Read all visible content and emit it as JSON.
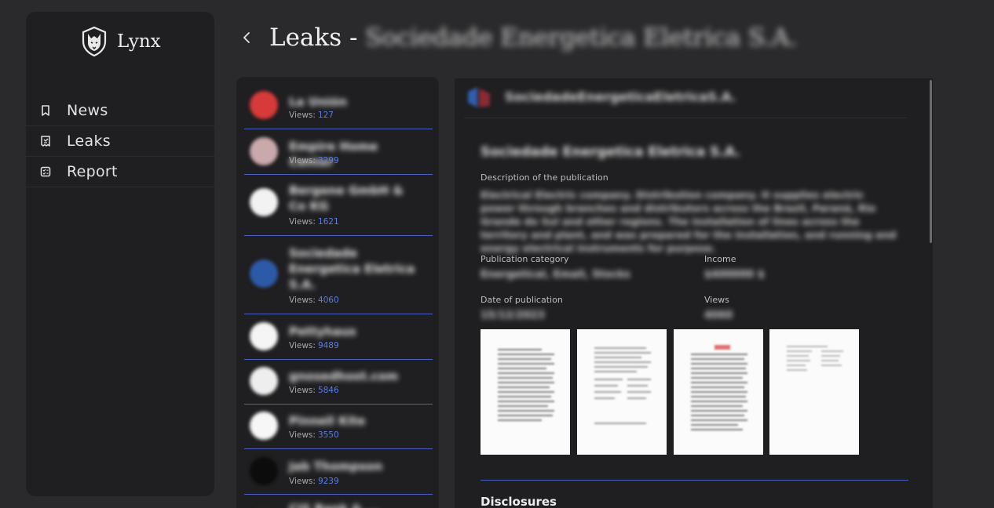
{
  "brand": {
    "name": "Lynx",
    "logo_icon": "wolf-shield-icon"
  },
  "sidebar": {
    "items": [
      {
        "label": "News",
        "icon": "bookmark-icon"
      },
      {
        "label": "Leaks",
        "icon": "receipt-icon"
      },
      {
        "label": "Report",
        "icon": "checklist-icon"
      }
    ]
  },
  "header": {
    "prefix": "Leaks - ",
    "org": "Sociedade Energetica Eletrica S.A."
  },
  "leaks_list": {
    "views_label": "Views:",
    "items": [
      {
        "name": "La Unión",
        "views": "127",
        "avatar_color": "#d83a3a"
      },
      {
        "name": "Empire Home Center",
        "views": "3299",
        "avatar_color": "#c9a9aa"
      },
      {
        "name": "Bergene GmbH & Co KG",
        "views": "1621",
        "avatar_color": "#f2f2f2"
      },
      {
        "name": "Sociedade Energetica Eletrica S.A.",
        "views": "4060",
        "avatar_color": "#2d5aa6"
      },
      {
        "name": "Pettyhaus",
        "views": "9489",
        "avatar_color": "#f5f5f5"
      },
      {
        "name": "gnosedhost.com",
        "views": "5846",
        "avatar_color": "#eeeeee"
      },
      {
        "name": "Pinnell Kite",
        "views": "3550",
        "avatar_color": "#f7f7f7"
      },
      {
        "name": "Jab Thompson",
        "views": "9239",
        "avatar_color": "#0c0c0c"
      },
      {
        "name": "CIS Bank & ...",
        "views": "",
        "avatar_color": "#222222"
      }
    ]
  },
  "detail": {
    "head_name": "SociedadeEnergeticaEletricaS.A.",
    "title": "Sociedade Energetica Eletrica S.A.",
    "description_label": "Description of the publication",
    "description": "Electrical Electric company. Distribution company. It supplies electric power through branches and distributors across the Brazil, Paraná, Rio Grande do Sul and other regions. The installation of lines across the territory and plant, and was prepared for the installation, and running and energy electrical instruments for purpose.",
    "category_label": "Publication category",
    "category": "Energetical, Email, Stocks",
    "income_label": "Income",
    "income": "$400000 $",
    "date_label": "Date of publication",
    "date": "15/12/2023",
    "views_label": "Views",
    "views": "4060",
    "disclosures_label": "Disclosures"
  }
}
